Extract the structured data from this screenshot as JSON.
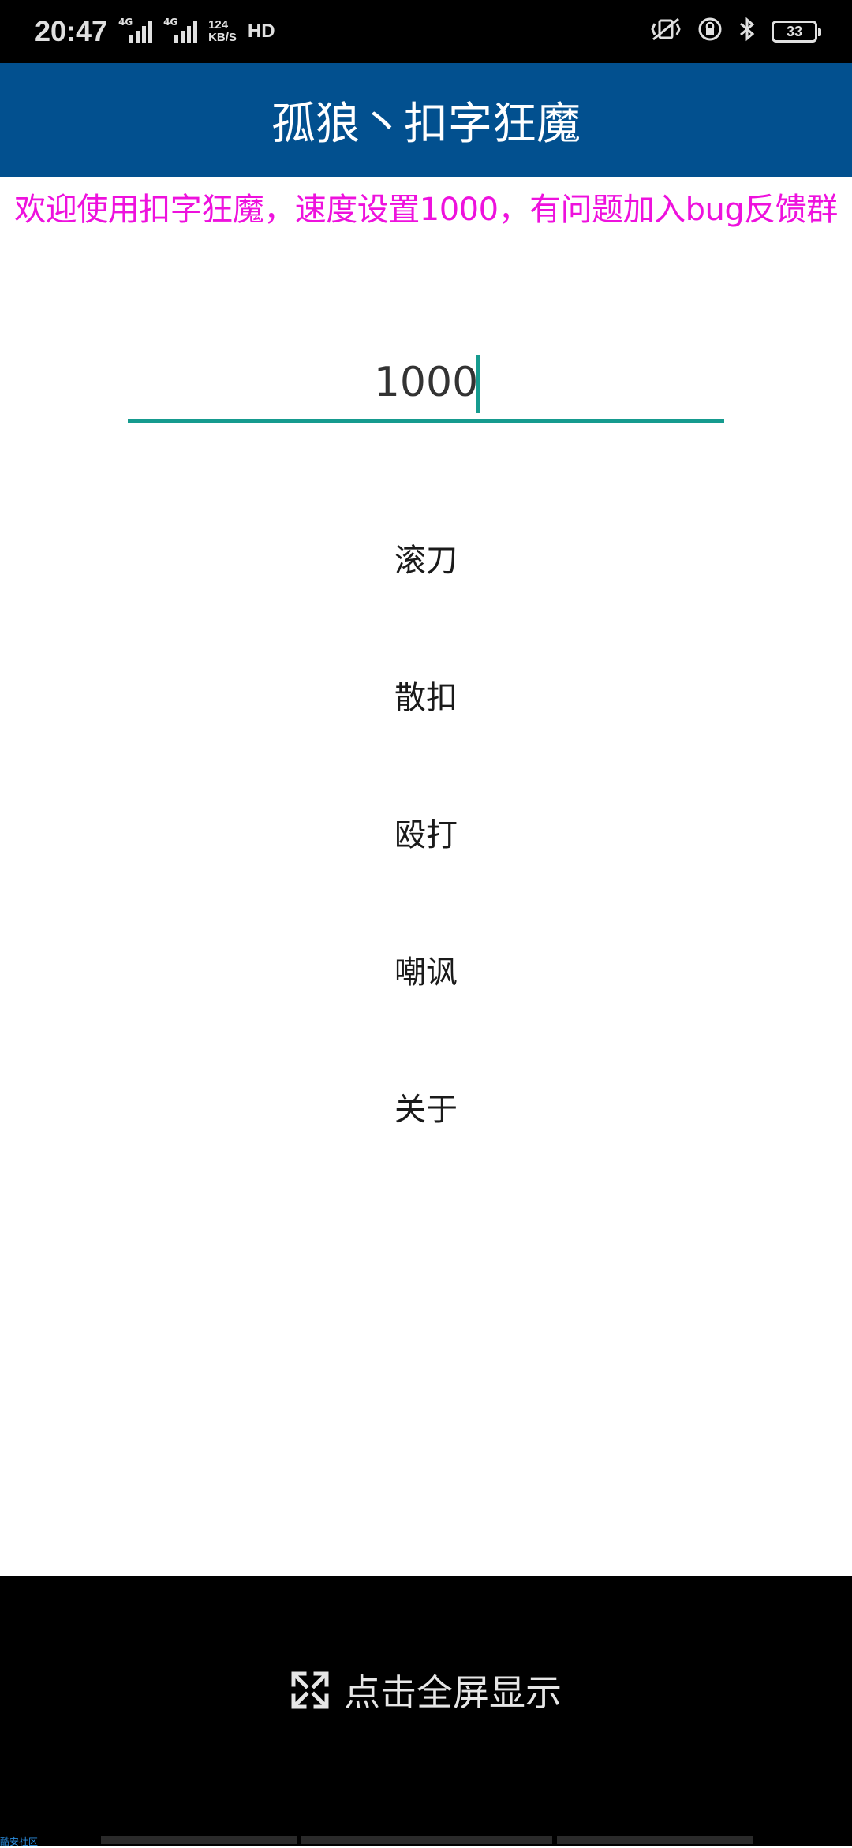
{
  "status_bar": {
    "time": "20:47",
    "network_tag_1": "4G",
    "network_tag_2": "4G",
    "speed_value": "124",
    "speed_unit": "KB/S",
    "hd_label": "HD",
    "battery_level": "33"
  },
  "app_bar": {
    "title": "孤狼丶扣字狂魔"
  },
  "notice": {
    "text": "欢迎使用扣字狂魔，速度设置1000，有问题加入bug反馈群"
  },
  "speed_input": {
    "value": "1000"
  },
  "menu": {
    "items": [
      {
        "label": "滚刀"
      },
      {
        "label": "散扣"
      },
      {
        "label": "殴打"
      },
      {
        "label": "嘲讽"
      },
      {
        "label": "关于"
      }
    ]
  },
  "fullscreen": {
    "label": "点击全屏显示"
  },
  "watermark": {
    "text": "酷安社区"
  },
  "colors": {
    "app_bar": "#02508f",
    "notice_text": "#ee11dd",
    "accent": "#169b8f"
  }
}
